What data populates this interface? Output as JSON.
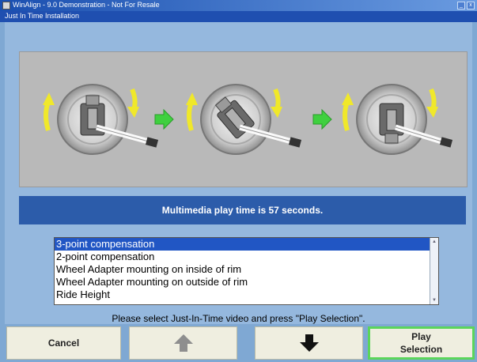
{
  "window": {
    "title": "WinAlign - 9.0 Demonstration - Not For Resale",
    "minimize_glyph": "_",
    "close_glyph": "x"
  },
  "dialog": {
    "title": "Just In Time Installation"
  },
  "illustration": {
    "wheel_count": 3,
    "curved_arrow_color": "#f0e82a",
    "step_arrow_color": "#3fd03f"
  },
  "banner": {
    "text": "Multimedia play time is 57 seconds."
  },
  "video_list": {
    "items": [
      "3-point compensation",
      "2-point compensation",
      "Wheel Adapter mounting on inside of rim",
      "Wheel Adapter mounting on outside of rim",
      "Ride Height"
    ],
    "selected_index": 0
  },
  "instruction": {
    "text": "Please select Just-In-Time video and press \"Play Selection\"."
  },
  "buttons": {
    "cancel": "Cancel",
    "up": "up-arrow-icon",
    "down": "down-arrow-icon",
    "play_line1": "Play",
    "play_line2": "Selection"
  },
  "colors": {
    "titlebar": "#1a4fb0",
    "banner": "#2c5caa",
    "selection": "#2156c4",
    "play_border": "#5bd55b",
    "button_face": "#efeee0"
  }
}
